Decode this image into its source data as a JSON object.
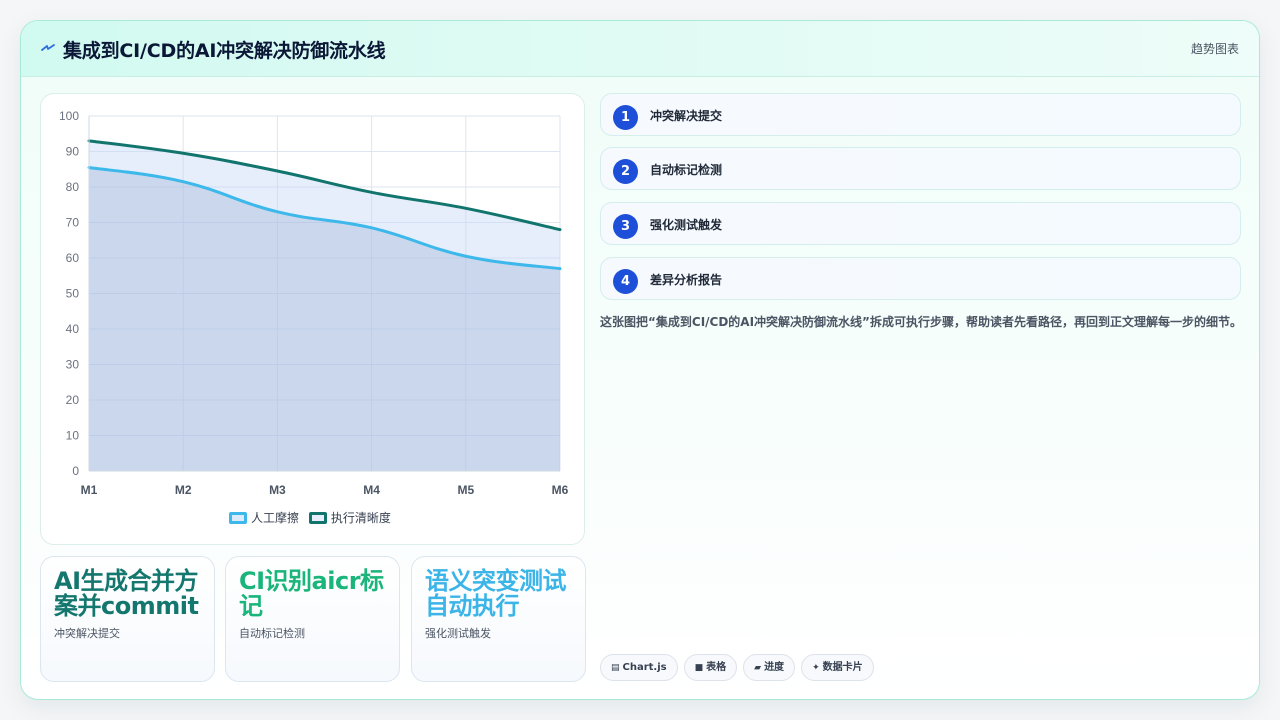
{
  "header": {
    "title": "集成到CI/CD的AI冲突解决防御流水线",
    "tag": "趋势图表"
  },
  "chart_data": {
    "type": "line",
    "categories": [
      "M1",
      "M2",
      "M3",
      "M4",
      "M5",
      "M6"
    ],
    "ylim": [
      0,
      100
    ],
    "yticks": [
      0,
      10,
      20,
      30,
      40,
      50,
      60,
      70,
      80,
      90,
      100
    ],
    "grid": true,
    "legend_position": "bottom",
    "series": [
      {
        "name": "人工摩擦",
        "values": [
          85.5,
          81.5,
          73,
          68.5,
          60.5,
          57
        ],
        "color": "#3db8ea",
        "fill": "rgba(141,166,205,0.30)"
      },
      {
        "name": "执行清晰度",
        "values": [
          93,
          89.5,
          84.5,
          78.5,
          74,
          68
        ],
        "color": "#12756d",
        "fill": "rgba(200,214,246,0.45)"
      }
    ]
  },
  "stats": [
    {
      "value": "AI生成合并方案并commit",
      "label": "冲突解决提交",
      "color": "#13776e"
    },
    {
      "value": "CI识别aicr标记",
      "label": "自动标记检测",
      "color": "#1ab57a"
    },
    {
      "value": "语义突变测试自动执行",
      "label": "强化测试触发",
      "color": "#3bb4e8"
    }
  ],
  "steps": [
    {
      "num": "1",
      "label": "冲突解决提交"
    },
    {
      "num": "2",
      "label": "自动标记检测"
    },
    {
      "num": "3",
      "label": "强化测试触发"
    },
    {
      "num": "4",
      "label": "差异分析报告"
    }
  ],
  "description": "这张图把“集成到CI/CD的AI冲突解决防御流水线”拆成可执行步骤，帮助读者先看路径，再回到正文理解每一步的细节。",
  "chips": [
    {
      "icon": "chart-icon",
      "glyph": "▤",
      "label": "Chart.js"
    },
    {
      "icon": "table-icon",
      "glyph": "■",
      "label": "表格"
    },
    {
      "icon": "progress-icon",
      "glyph": "▰",
      "label": "进度"
    },
    {
      "icon": "sparkle-icon",
      "glyph": "✦",
      "label": "数据卡片"
    }
  ]
}
